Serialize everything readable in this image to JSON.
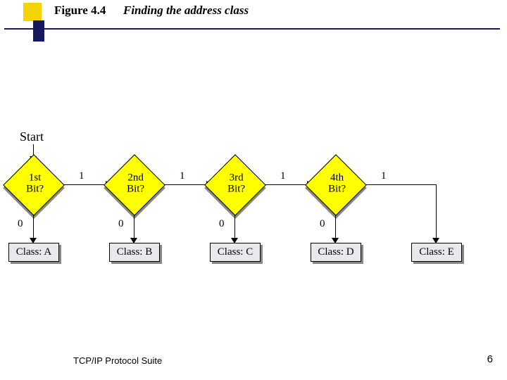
{
  "header": {
    "figure_label": "Figure 4.4",
    "figure_title": "Finding the address class"
  },
  "diagram": {
    "start_label": "Start",
    "nodes": [
      {
        "decision": "1st\nBit?",
        "branch_right": "1",
        "branch_down": "0",
        "result": "Class: A"
      },
      {
        "decision": "2nd\nBit?",
        "branch_right": "1",
        "branch_down": "0",
        "result": "Class: B"
      },
      {
        "decision": "3rd\nBit?",
        "branch_right": "1",
        "branch_down": "0",
        "result": "Class: C"
      },
      {
        "decision": "4th\nBit?",
        "branch_right": "1",
        "branch_down": "0",
        "result": "Class: D"
      }
    ],
    "final_result": "Class: E"
  },
  "footer": {
    "left": "TCP/IP Protocol Suite",
    "page": "6"
  },
  "colors": {
    "diamond_fill": "#ffff00",
    "box_fill": "#e9e9ed",
    "accent_yellow": "#f3d400",
    "accent_navy": "#17175d"
  }
}
